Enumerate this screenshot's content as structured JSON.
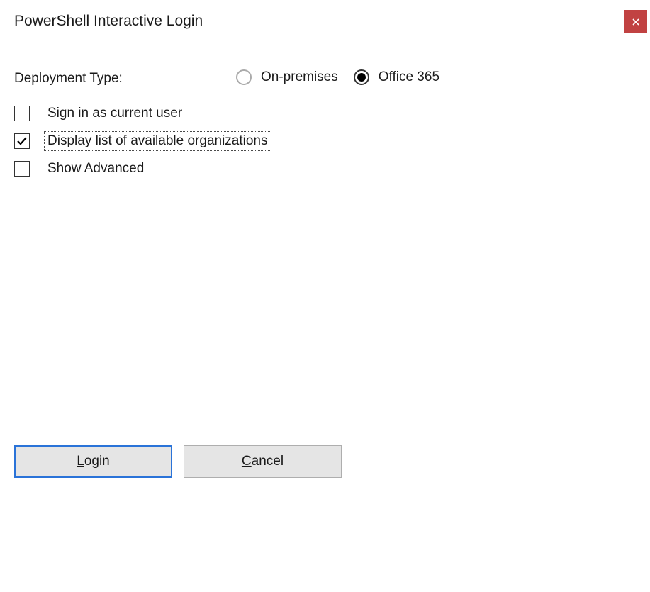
{
  "title": "PowerShell Interactive Login",
  "close_label": "×",
  "deployment": {
    "label": "Deployment Type:",
    "options": {
      "onprem": "On-premises",
      "o365": "Office 365"
    },
    "selected": "o365"
  },
  "checkboxes": {
    "sign_in_current": {
      "label": "Sign in as current user",
      "checked": false
    },
    "display_orgs": {
      "label": "Display list of available organizations",
      "checked": true,
      "focused": true
    },
    "show_advanced": {
      "label": "Show Advanced",
      "checked": false
    }
  },
  "buttons": {
    "login_pre": "L",
    "login_rest": "ogin",
    "cancel_pre": "C",
    "cancel_rest": "ancel"
  }
}
